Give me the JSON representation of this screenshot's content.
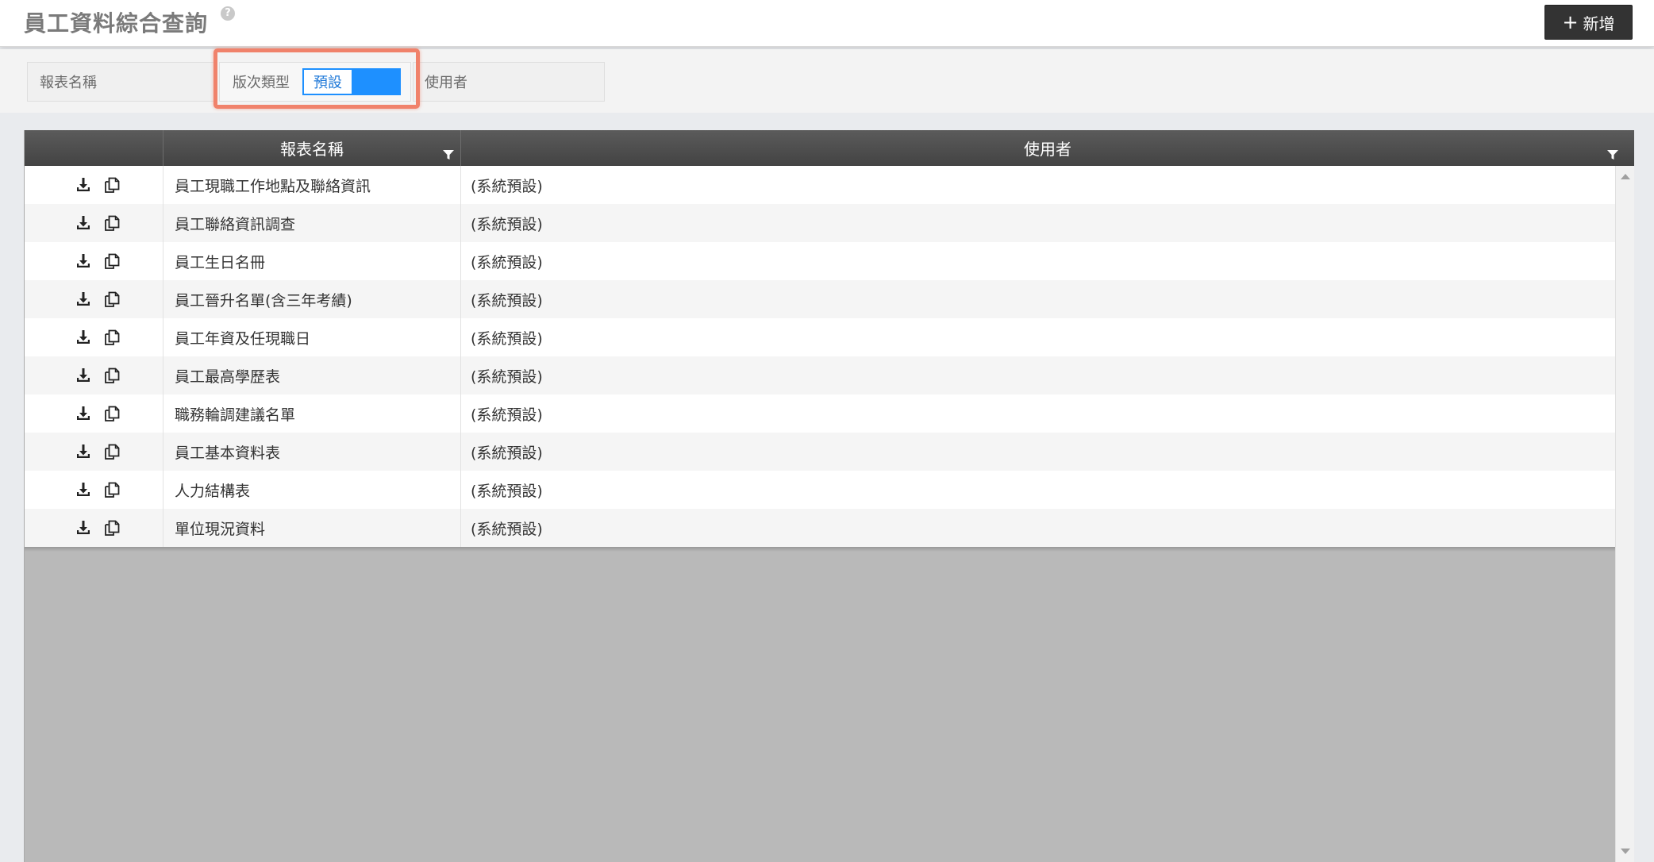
{
  "header": {
    "title": "員工資料綜合查詢",
    "help_icon": "question-circle-icon",
    "add_button_label": "新增",
    "add_button_icon": "plus-icon"
  },
  "filters": {
    "report_name_label": "報表名稱",
    "version_type_label": "版次類型",
    "version_type_value": "預設",
    "user_label": "使用者"
  },
  "grid": {
    "columns": [
      "",
      "報表名稱",
      "使用者"
    ],
    "row_action_icons": [
      "download-icon",
      "copy-icon"
    ],
    "rows": [
      {
        "name": "員工現職工作地點及聯絡資訊",
        "user": "(系統預設)"
      },
      {
        "name": "員工聯絡資訊調查",
        "user": "(系統預設)"
      },
      {
        "name": "員工生日名冊",
        "user": "(系統預設)"
      },
      {
        "name": "員工晉升名單(含三年考績)",
        "user": "(系統預設)"
      },
      {
        "name": "員工年資及任現職日",
        "user": "(系統預設)"
      },
      {
        "name": "員工最高學歷表",
        "user": "(系統預設)"
      },
      {
        "name": "職務輪調建議名單",
        "user": "(系統預設)"
      },
      {
        "name": "員工基本資料表",
        "user": "(系統預設)"
      },
      {
        "name": "人力結構表",
        "user": "(系統預設)"
      },
      {
        "name": "單位現況資料",
        "user": "(系統預設)"
      }
    ]
  },
  "colors": {
    "accent": "#1e90ff",
    "highlight": "#f0826b",
    "header_bg": "#4a4a4a"
  }
}
